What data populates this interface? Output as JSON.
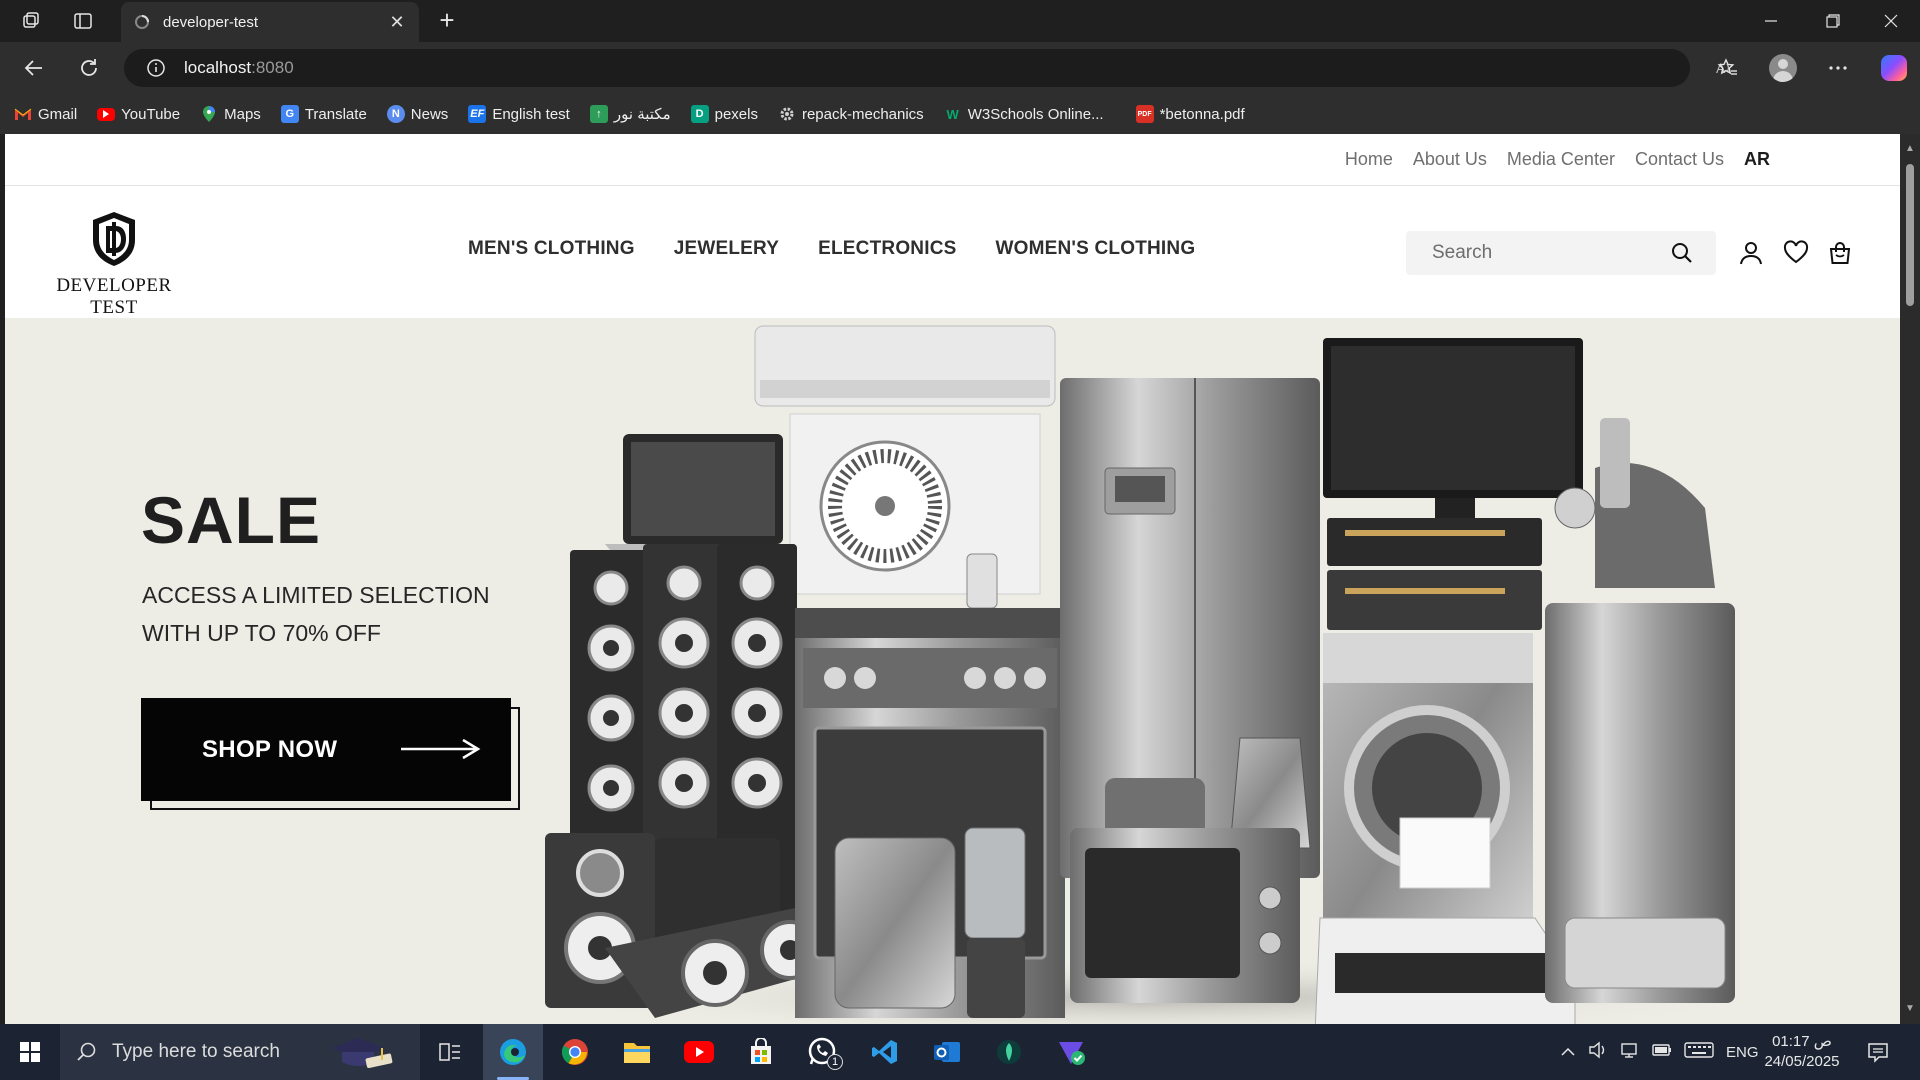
{
  "browser": {
    "tab_title": "developer-test",
    "url_host": "localhost",
    "url_port": ":8080",
    "bookmarks": [
      {
        "label": "Gmail",
        "icon": "gmail-icon",
        "color": "#ea4335"
      },
      {
        "label": "YouTube",
        "icon": "youtube-icon",
        "color": "#ff0000"
      },
      {
        "label": "Maps",
        "icon": "maps-icon",
        "color": "#34a853"
      },
      {
        "label": "Translate",
        "icon": "translate-icon",
        "color": "#4285f4"
      },
      {
        "label": "News",
        "icon": "news-icon",
        "color": "#4285f4"
      },
      {
        "label": "English test",
        "icon": "ef-icon",
        "color": "#1a73e8"
      },
      {
        "label": "مكتبة نور",
        "icon": "noor-icon",
        "color": "#2e9d5a"
      },
      {
        "label": "pexels",
        "icon": "pexels-icon",
        "color": "#05a081"
      },
      {
        "label": "repack-mechanics",
        "icon": "gear-icon",
        "color": "#aaaaaa"
      },
      {
        "label": "W3Schools Online...",
        "icon": "w3schools-icon",
        "color": "#04aa6d"
      },
      {
        "label": "*betonna.pdf",
        "icon": "pdf-icon",
        "color": "#d93025"
      }
    ]
  },
  "site": {
    "brand": "DEVELOPER TEST",
    "top_nav": [
      "Home",
      "About Us",
      "Media Center",
      "Contact Us"
    ],
    "lang": "AR",
    "main_nav": [
      "MEN'S CLOTHING",
      "JEWELERY",
      "ELECTRONICS",
      "WOMEN'S CLOTHING"
    ],
    "search_placeholder": "Search",
    "hero": {
      "title": "SALE",
      "subtitle": "ACCESS A LIMITED SELECTION WITH UP TO 70% OFF",
      "cta": "SHOP NOW"
    }
  },
  "taskbar": {
    "search_placeholder": "Type here to search",
    "lang": "ENG",
    "time": "01:17 ص",
    "date": "24/05/2025",
    "whatsapp_badge": "1"
  }
}
